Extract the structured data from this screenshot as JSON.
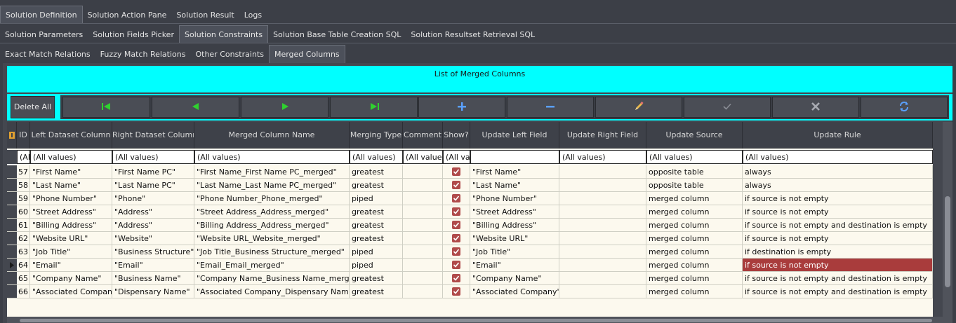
{
  "tabs_level1": [
    "Solution Definition",
    "Solution Action Pane",
    "Solution Result",
    "Logs"
  ],
  "tabs_level2": [
    "Solution Parameters",
    "Solution Fields Picker",
    "Solution Constraints",
    "Solution Base Table Creation SQL",
    "Solution Resultset Retrieval SQL"
  ],
  "tabs_level3": [
    "Exact Match Relations",
    "Fuzzy Match Relations",
    "Other Constraints",
    "Merged Columns"
  ],
  "panel_title": "List of Merged Columns",
  "delete_all_label": "Delete All",
  "nav_icons": [
    "first-record-icon",
    "prior-record-icon",
    "next-record-icon",
    "last-record-icon",
    "insert-icon",
    "delete-icon",
    "edit-icon",
    "post-icon",
    "cancel-icon",
    "refresh-icon"
  ],
  "columns": [
    "ID",
    "Left Dataset Column",
    "Right Dataset Column",
    "Merged Column Name",
    "Merging Type",
    "Comment",
    "Show?",
    "Update Left Field",
    "Update Right Field",
    "Update Source",
    "Update Rule"
  ],
  "filters": [
    "(Al",
    "(All values)",
    "(All values)",
    "(All values)",
    "(All values)",
    "(All values",
    "(All va",
    "",
    "(All values)",
    "(All values)",
    "(All values)"
  ],
  "rows": [
    {
      "id": "57",
      "left": "\"First Name\"",
      "right": "\"First Name PC\"",
      "merged": "\"First Name_First Name PC_merged\"",
      "type": "greatest",
      "comment": "",
      "show": true,
      "upd_left": "\"First Name\"",
      "upd_right": "",
      "source": "opposite table",
      "rule": "always"
    },
    {
      "id": "58",
      "left": "\"Last Name\"",
      "right": "\"Last Name PC\"",
      "merged": "\"Last Name_Last Name PC_merged\"",
      "type": "greatest",
      "comment": "",
      "show": true,
      "upd_left": "\"Last Name\"",
      "upd_right": "",
      "source": "opposite table",
      "rule": "always"
    },
    {
      "id": "59",
      "left": "\"Phone Number\"",
      "right": "\"Phone\"",
      "merged": "\"Phone Number_Phone_merged\"",
      "type": "piped",
      "comment": "",
      "show": true,
      "upd_left": "\"Phone Number\"",
      "upd_right": "",
      "source": "merged column",
      "rule": "if source is not empty"
    },
    {
      "id": "60",
      "left": "\"Street Address\"",
      "right": "\"Address\"",
      "merged": "\"Street Address_Address_merged\"",
      "type": "greatest",
      "comment": "",
      "show": true,
      "upd_left": "\"Street Address\"",
      "upd_right": "",
      "source": "merged column",
      "rule": "if source is not empty"
    },
    {
      "id": "61",
      "left": "\"Billing Address\"",
      "right": "\"Address\"",
      "merged": "\"Billing Address_Address_merged\"",
      "type": "greatest",
      "comment": "",
      "show": true,
      "upd_left": "\"Billing Address\"",
      "upd_right": "",
      "source": "merged column",
      "rule": "if source is not empty and destination is empty"
    },
    {
      "id": "62",
      "left": "\"Website URL\"",
      "right": "\"Website\"",
      "merged": "\"Website URL_Website_merged\"",
      "type": "greatest",
      "comment": "",
      "show": true,
      "upd_left": "\"Website URL\"",
      "upd_right": "",
      "source": "merged column",
      "rule": "if source is not empty"
    },
    {
      "id": "63",
      "left": "\"Job Title\"",
      "right": "\"Business Structure\"",
      "merged": "\"Job Title_Business Structure_merged\"",
      "type": "piped",
      "comment": "",
      "show": true,
      "upd_left": "\"Job Title\"",
      "upd_right": "",
      "source": "merged column",
      "rule": "if destination is empty"
    },
    {
      "id": "64",
      "left": "\"Email\"",
      "right": "\"Email\"",
      "merged": "\"Email_Email_merged\"",
      "type": "piped",
      "comment": "",
      "show": true,
      "upd_left": "\"Email\"",
      "upd_right": "",
      "source": "merged column",
      "rule": "if source is not empty"
    },
    {
      "id": "65",
      "left": "\"Company Name\"",
      "right": "\"Business Name\"",
      "merged": "\"Company Name_Business Name_merged\"",
      "type": "greatest",
      "comment": "",
      "show": true,
      "upd_left": "\"Company Name\"",
      "upd_right": "",
      "source": "merged column",
      "rule": "if source is not empty and destination is empty"
    },
    {
      "id": "66",
      "left": "\"Associated Company\"",
      "right": "\"Dispensary Name\"",
      "merged": "\"Associated Company_Dispensary Name_merged\"",
      "type": "greatest",
      "comment": "",
      "show": true,
      "upd_left": "\"Associated Company\"",
      "upd_right": "",
      "source": "merged column",
      "rule": "if source is not empty and destination is empty"
    }
  ],
  "current_row_id": "64",
  "colors": {
    "header_accent": "#00ffff",
    "selected_cell": "#a93c3c",
    "grid_bg": "#fcf9ee",
    "nav_green": "#2fd12f",
    "nav_blue": "#5aa0ff"
  }
}
